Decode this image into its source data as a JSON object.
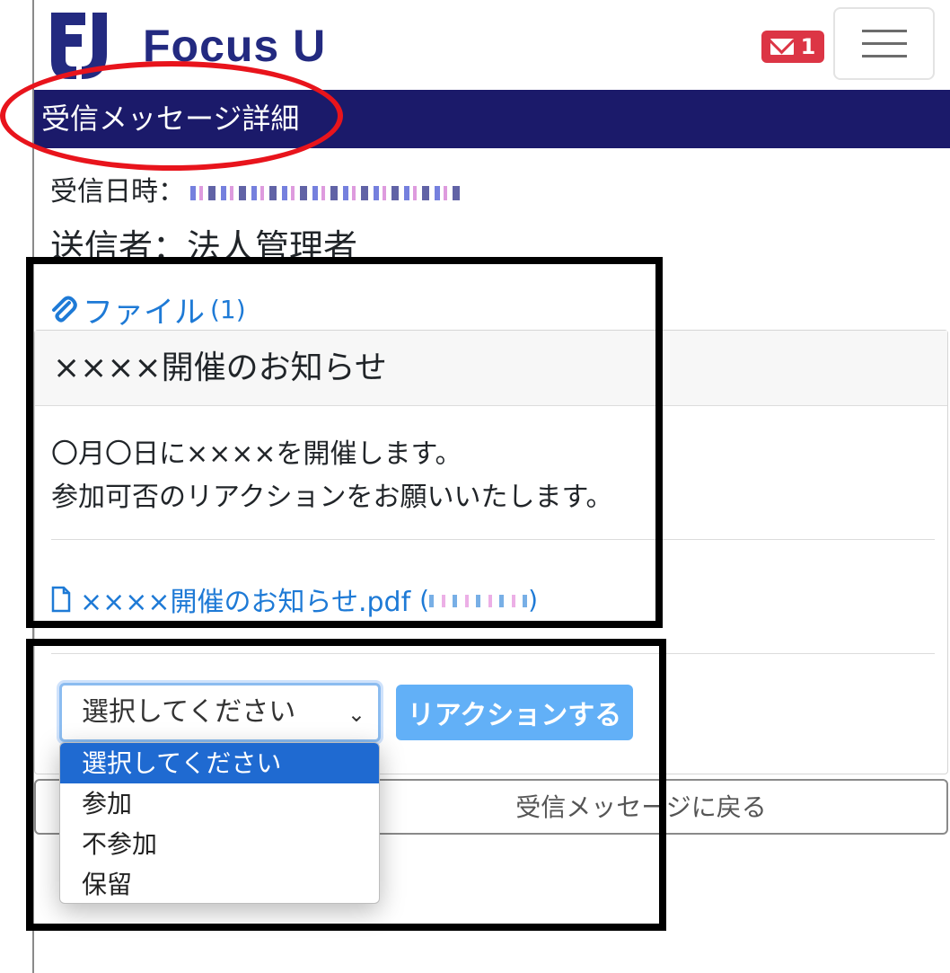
{
  "header": {
    "brand_name": "Focus U",
    "unread_count": "1"
  },
  "page": {
    "title": "受信メッセージ詳細",
    "received_label": "受信日時：",
    "sender_label": "送信者：",
    "sender_name": "法人管理者"
  },
  "attachments": {
    "label": "ファイル",
    "count": "(1)"
  },
  "message": {
    "subject": "××××開催のお知らせ",
    "body_line1": "〇月〇日に××××を開催します。",
    "body_line2": "参加可否のリアクションをお願いいたします。",
    "file_name": "××××開催のお知らせ.pdf"
  },
  "reaction": {
    "select_value": "選択してください",
    "options": [
      "選択してください",
      "参加",
      "不参加",
      "保留"
    ],
    "submit_label": "リアクションする"
  },
  "back_label": "受信メッセージに戻る",
  "colors": {
    "brand_navy": "#1b1a6a",
    "badge_red": "#dc3545",
    "link_blue": "#1e7ad6",
    "button_blue": "#62b0f7",
    "highlight_red": "#e8141c"
  }
}
